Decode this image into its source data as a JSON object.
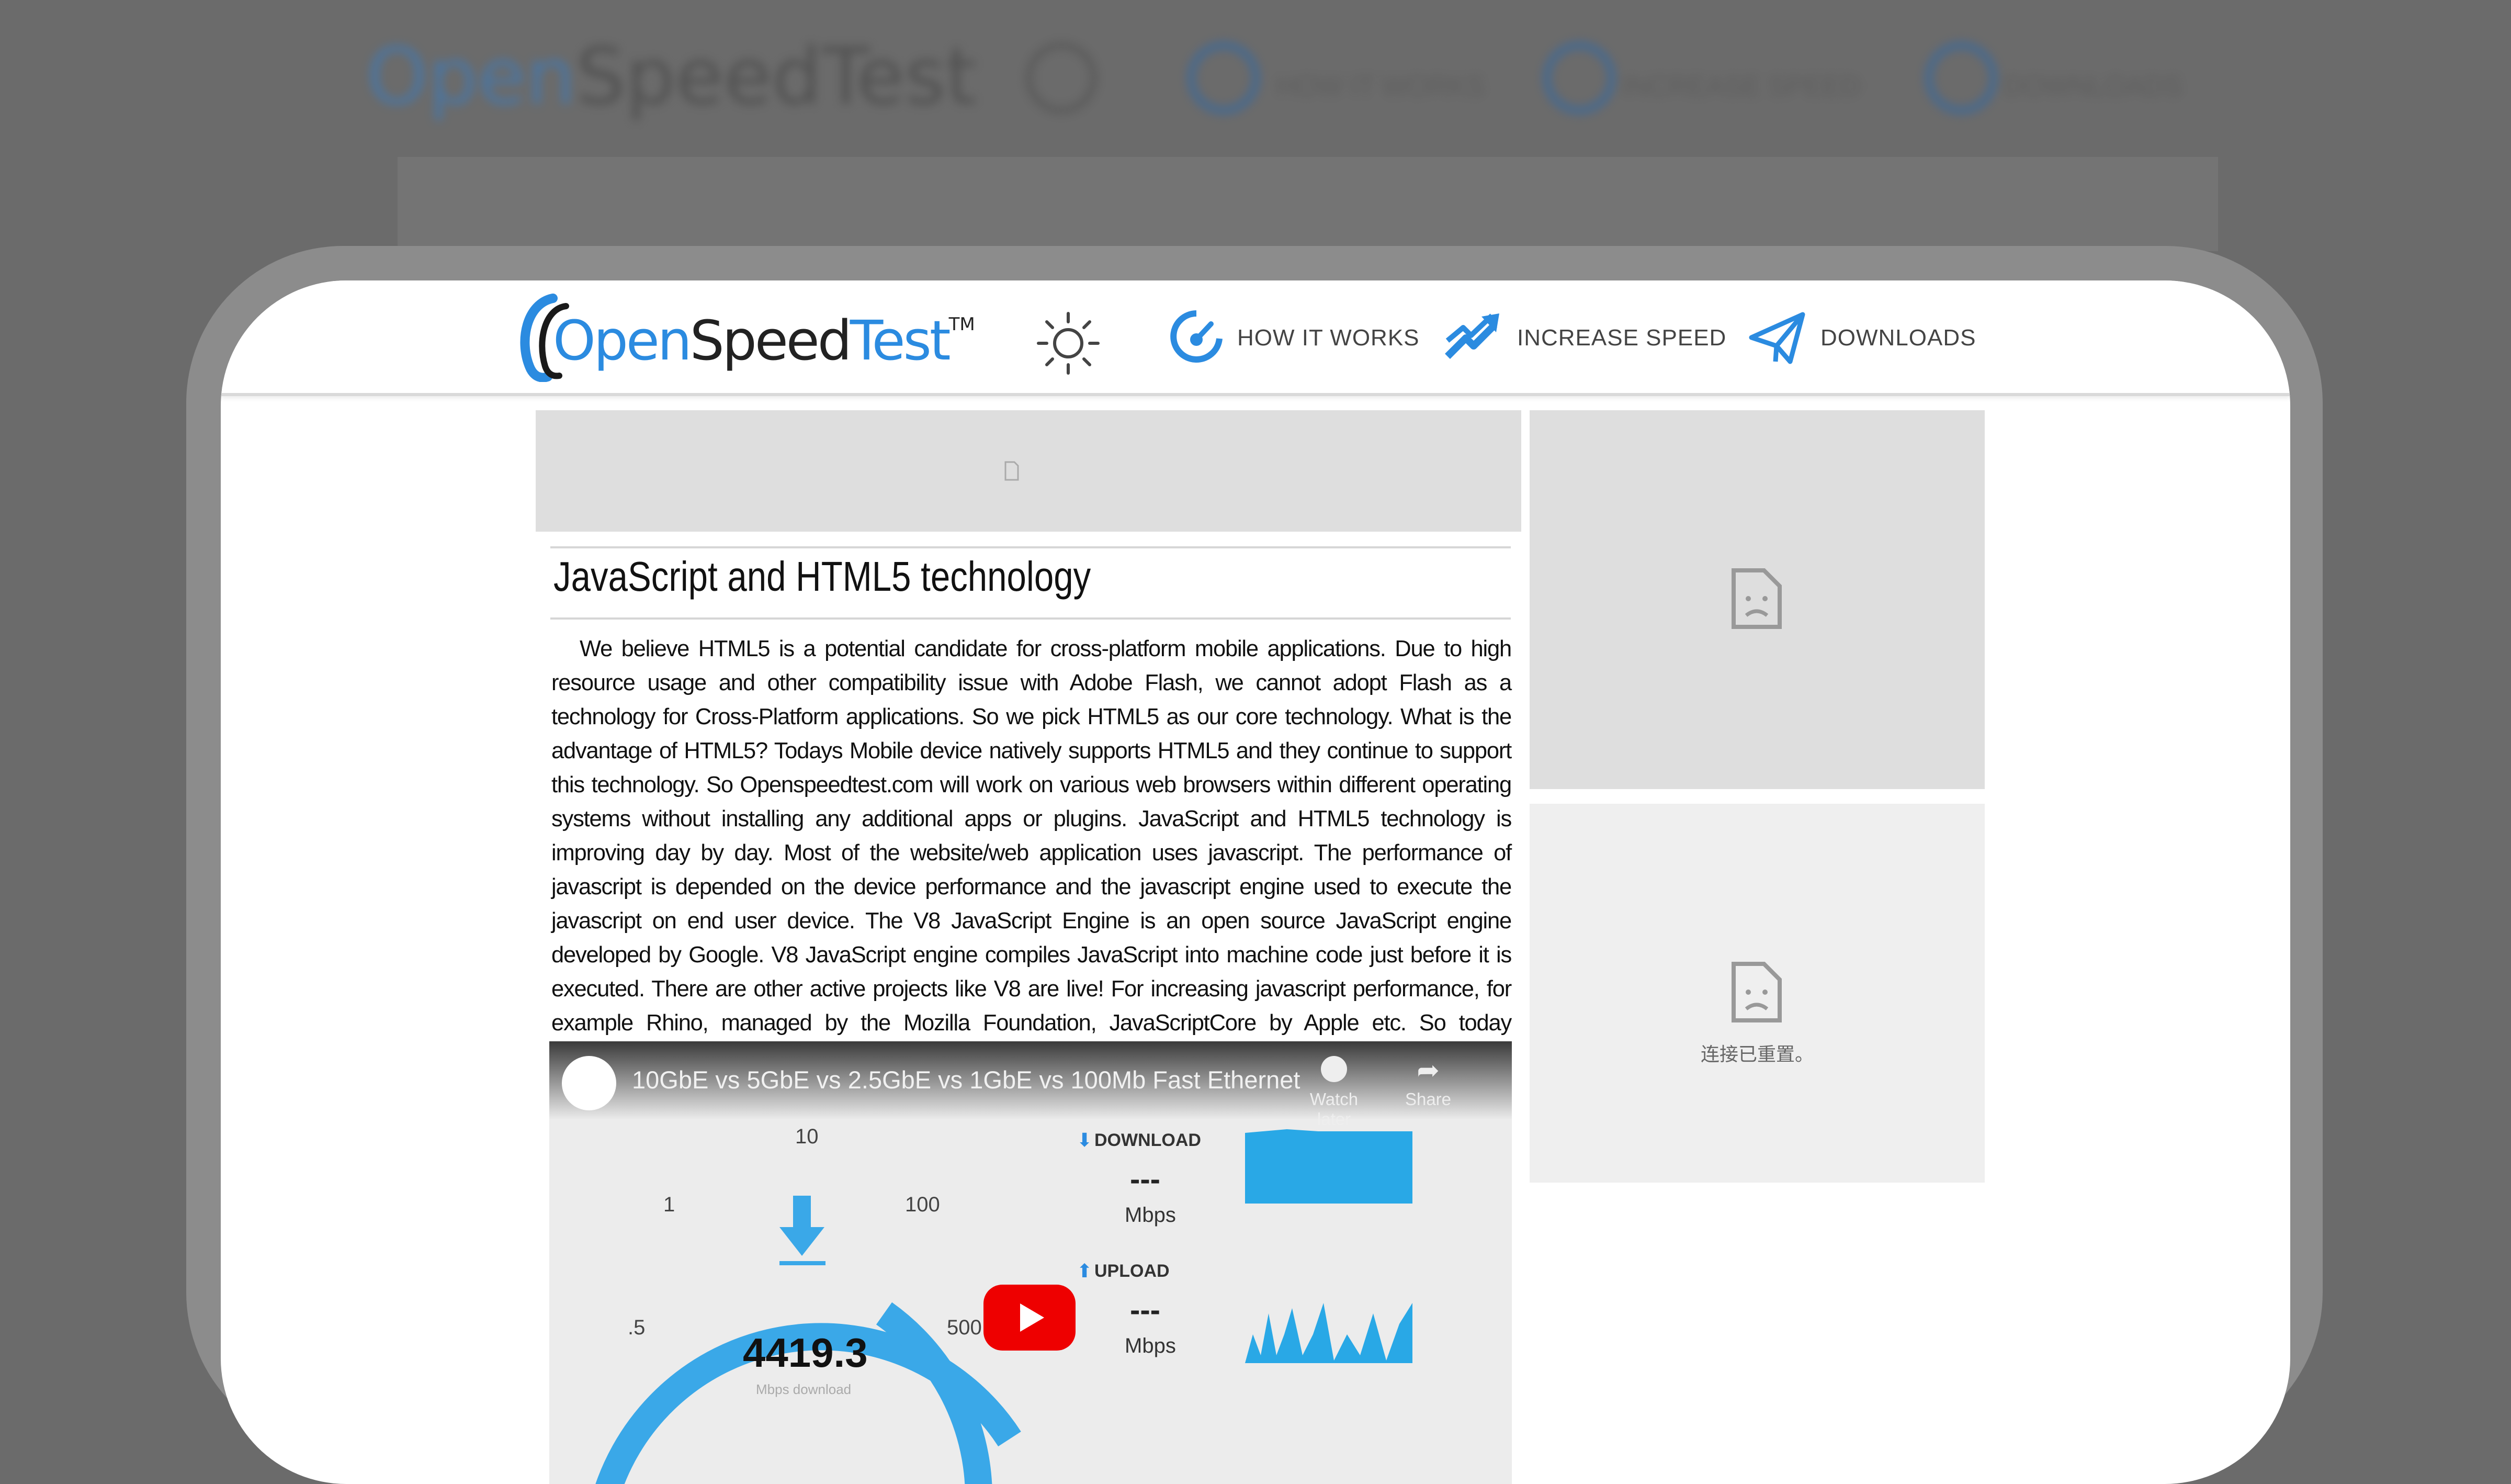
{
  "background_header": {
    "logo_text_open": "Open",
    "logo_text_speed": "SpeedTest",
    "nav": [
      "HOW IT WORKS",
      "INCREASE SPEED",
      "DOWNLOADS"
    ]
  },
  "nav": {
    "logo": {
      "open": "O",
      "pen": "pen",
      "speed": "Speed",
      "test": "Test",
      "tm": "TM"
    },
    "theme_toggle_icon": "sun-icon",
    "items": [
      {
        "label": "HOW IT WORKS",
        "icon": "speedometer-icon"
      },
      {
        "label": "INCREASE SPEED",
        "icon": "double-arrow-icon"
      },
      {
        "label": "DOWNLOADS",
        "icon": "paper-plane-icon"
      }
    ]
  },
  "article": {
    "title": "JavaScript and HTML5 technology",
    "body": "We believe HTML5 is a potential candidate for cross-platform mobile applications. Due to high resource usage and other compatibility issue with Adobe Flash, we cannot adopt Flash as a technology for Cross-Platform applications. So we pick HTML5 as our core technology. What is the advantage of HTML5? Todays Mobile device natively supports HTML5 and they continue to support this technology. So Openspeedtest.com will work on various web browsers within different operating systems without installing any additional apps or plugins. JavaScript and HTML5 technology is improving day by day. Most of the website/web application uses javascript. The performance of javascript is depended on the device performance and the javascript engine used to execute the javascript on end user device. The V8 JavaScript Engine is an open source JavaScript engine developed by Google. V8 JavaScript engine compiles JavaScript into machine code just before it is executed. There are other active projects like V8 are live! For increasing javascript performance, for example Rhino, managed by the Mozilla Foundation, JavaScriptCore by Apple etc. So today javascript is more powerful than ever."
  },
  "sidebar": {
    "ad2_message": "连接已重置。"
  },
  "video": {
    "title": "10GbE vs 5GbE vs 2.5GbE vs 1GbE vs 100Mb Fast Ethernet",
    "watch_later": "Watch later",
    "share": "Share",
    "gauge_ticks": {
      "t10": "10",
      "t1": "1",
      "t100": "100",
      "t5": ".5",
      "t500": "500"
    },
    "speed_value": "4419.3",
    "speed_caption": "Mbps download",
    "download": {
      "label": "DOWNLOAD",
      "value": "---",
      "unit": "Mbps"
    },
    "upload": {
      "label": "UPLOAD",
      "value": "---",
      "unit": "Mbps"
    }
  },
  "colors": {
    "accent_blue": "#2b8be0",
    "youtube_red": "#e00000",
    "gauge_blue": "#3aa8e8"
  }
}
